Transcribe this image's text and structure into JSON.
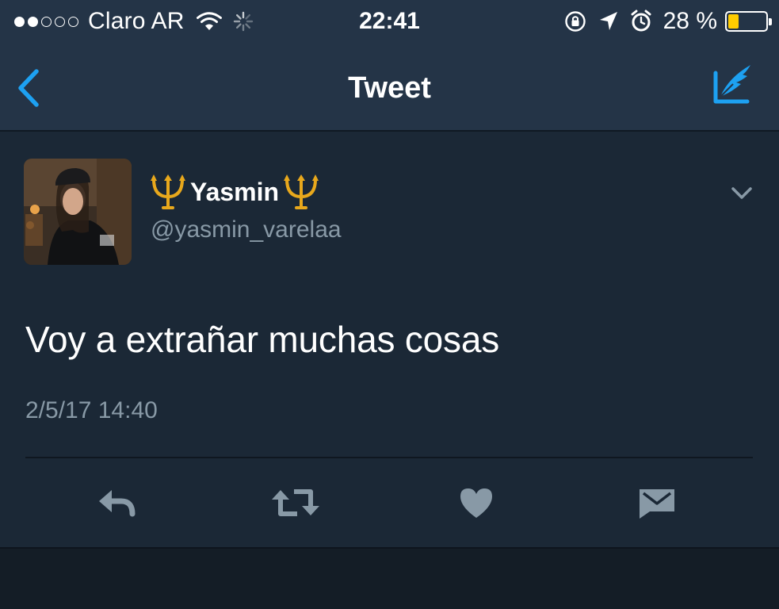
{
  "status_bar": {
    "signal_dots": [
      "full",
      "full",
      "empty",
      "empty",
      "empty"
    ],
    "carrier": "Claro AR",
    "time": "22:41",
    "battery_percent": "28 %",
    "battery_level": 0.28,
    "battery_color": "#ffcc00"
  },
  "nav": {
    "title": "Tweet",
    "accent": "#1da1f2"
  },
  "tweet": {
    "display_name": "Yasmin",
    "name_emoji": "trident-emblem-icon",
    "handle": "@yasmin_varelaa",
    "text": "Voy a extrañar muchas cosas",
    "timestamp": "2/5/17 14:40"
  },
  "actions": [
    "reply-icon",
    "retweet-icon",
    "like-icon",
    "direct-message-icon"
  ],
  "colors": {
    "background": "#1b2836",
    "bar": "#243447",
    "secondary_text": "#8899a6",
    "icon": "#8899a6"
  }
}
